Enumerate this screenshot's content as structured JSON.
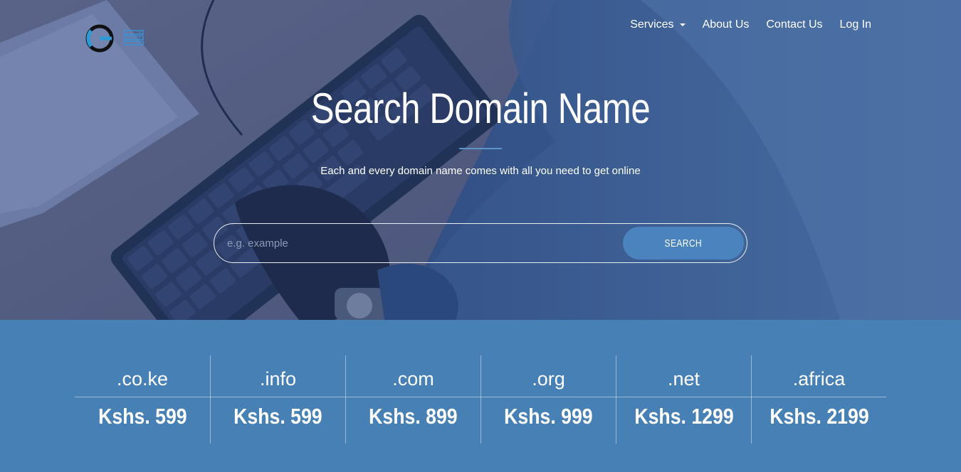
{
  "nav": {
    "items": [
      {
        "label": "Services",
        "dropdown": true
      },
      {
        "label": "About Us"
      },
      {
        "label": "Contact Us"
      },
      {
        "label": "Log In"
      }
    ]
  },
  "hero": {
    "title": "Search Domain Name",
    "subtitle": "Each and every domain name comes with all you need to get online"
  },
  "search": {
    "placeholder": "e.g. example",
    "button_label": "SEARCH"
  },
  "pricing": [
    {
      "tld": ".co.ke",
      "price": "Kshs. 599"
    },
    {
      "tld": ".info",
      "price": "Kshs. 599"
    },
    {
      "tld": ".com",
      "price": "Kshs. 899"
    },
    {
      "tld": ".org",
      "price": "Kshs. 999"
    },
    {
      "tld": ".net",
      "price": "Kshs. 1299"
    },
    {
      "tld": ".africa",
      "price": "Kshs. 2199"
    }
  ],
  "colors": {
    "accent": "#4780b5",
    "button": "#4a83bd"
  }
}
